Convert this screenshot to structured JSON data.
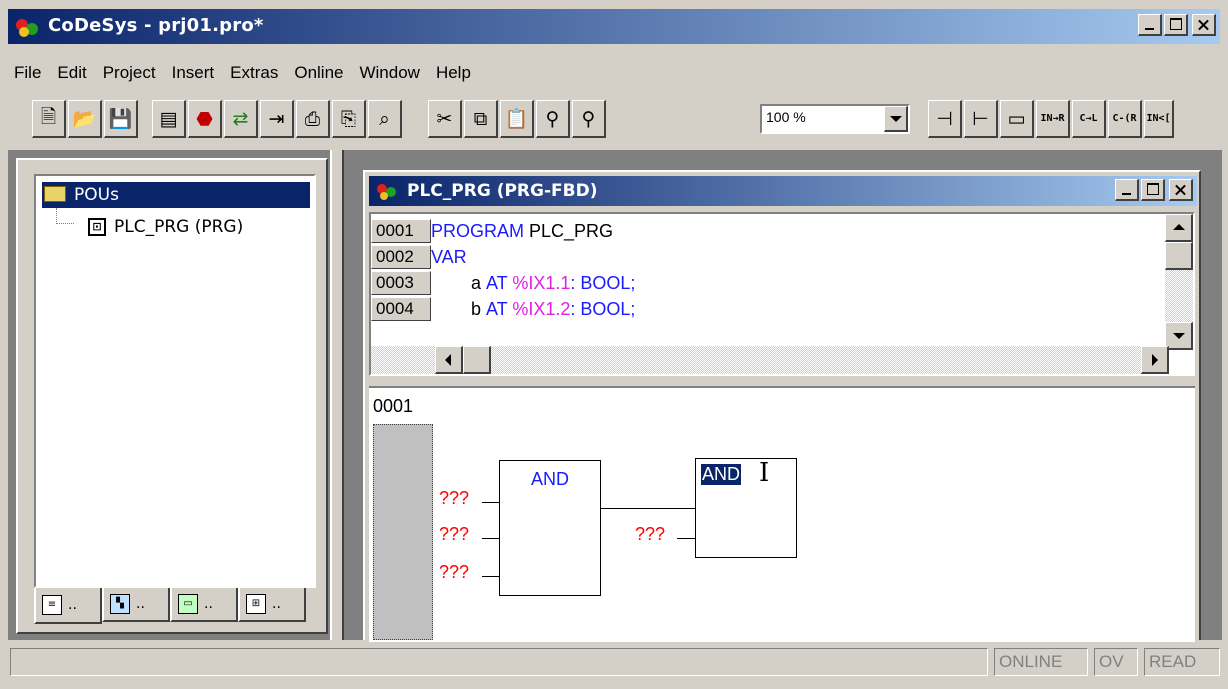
{
  "window": {
    "title": "CoDeSys - prj01.pro*"
  },
  "menu": [
    "File",
    "Edit",
    "Project",
    "Insert",
    "Extras",
    "Online",
    "Window",
    "Help"
  ],
  "toolbar": {
    "zoom_value": "100 %",
    "buttons": [
      "new-icon",
      "open-icon",
      "save-icon",
      "build-icon",
      "stop-icon",
      "login-icon",
      "logout-icon",
      "print-icon",
      "print-options-icon",
      "find-icon",
      "cut-icon",
      "copy-icon",
      "paste-icon",
      "find-replace-icon",
      "find-next-icon",
      "network-before-icon",
      "network-after-icon",
      "box-icon",
      "input-icon",
      "assign-icon",
      "return-icon",
      "jump-icon"
    ],
    "small_labels": [
      "IN→R",
      "C→L",
      "C-(R",
      "IN<["
    ]
  },
  "pou_tree": {
    "root": "POUs",
    "children": [
      "PLC_PRG (PRG)"
    ],
    "tabs": [
      "..",
      "..",
      "..",
      ".."
    ]
  },
  "editor": {
    "title": "PLC_PRG (PRG-FBD)",
    "declarations": [
      {
        "num": "0001",
        "kw": "PROGRAM",
        "text": " PLC_PRG",
        "addr": "",
        "tail": ""
      },
      {
        "num": "0002",
        "kw": "VAR",
        "text": "",
        "addr": "",
        "tail": ""
      },
      {
        "num": "0003",
        "kw": "",
        "text": "a ",
        "kw2": "AT ",
        "addr": "%IX1.1",
        "tail": ": BOOL;"
      },
      {
        "num": "0004",
        "kw": "",
        "text": "b ",
        "kw2": "AT ",
        "addr": "%IX1.2",
        "tail": ": BOOL;"
      }
    ],
    "network": {
      "number": "0001",
      "block1": "AND",
      "block2": "AND",
      "placeholder": "???"
    }
  },
  "status": {
    "online": "ONLINE",
    "ov": "OV",
    "read": "READ"
  },
  "colors": {
    "keyword": "#1a1aff",
    "address": "#e020e0",
    "placeholder": "#ff0000",
    "title_active": "#0a246a"
  }
}
